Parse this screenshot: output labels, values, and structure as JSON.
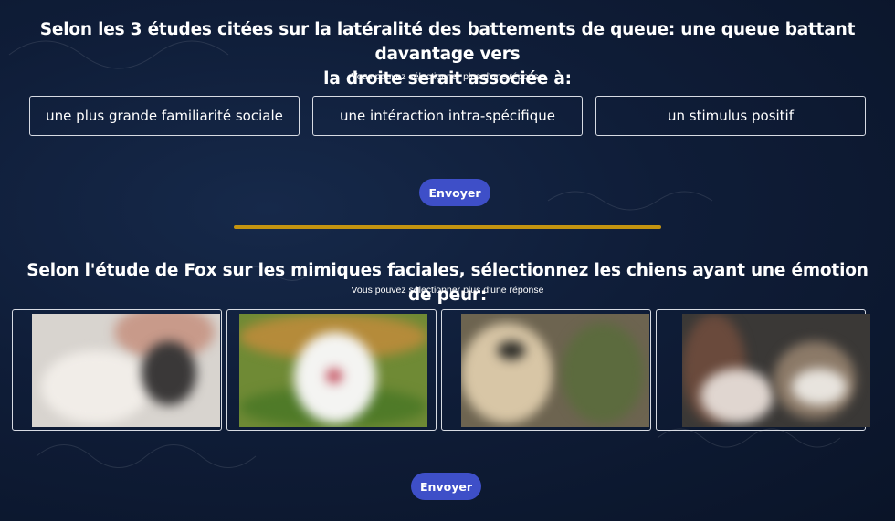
{
  "question1": {
    "title_line1": "Selon les 3 études citées sur la latéralité des battements de queue: une queue battant davantage vers",
    "title_line2": "la droite serait associée à:",
    "subtitle": "Vous pouvez sélectionner plus d'une réponse",
    "options": [
      {
        "label": "une plus grande familiarité sociale"
      },
      {
        "label": "une intéraction intra-spécifique"
      },
      {
        "label": "un stimulus positif"
      }
    ],
    "submit_label": "Envoyer"
  },
  "question2": {
    "title": "Selon l'étude de Fox sur les mimiques faciales, sélectionnez les chiens ayant une émotion de peur:",
    "subtitle": "Vous pouvez sélectionner plus d'une réponse",
    "images": [
      {
        "icon": "dog-photo-1"
      },
      {
        "icon": "dog-photo-2"
      },
      {
        "icon": "dog-photo-3"
      },
      {
        "icon": "dog-photo-4"
      }
    ],
    "submit_label": "Envoyer"
  },
  "colors": {
    "background": "#0f1d38",
    "button": "#3e4fc8",
    "divider": "#c49410",
    "border": "#d7dbe3"
  }
}
